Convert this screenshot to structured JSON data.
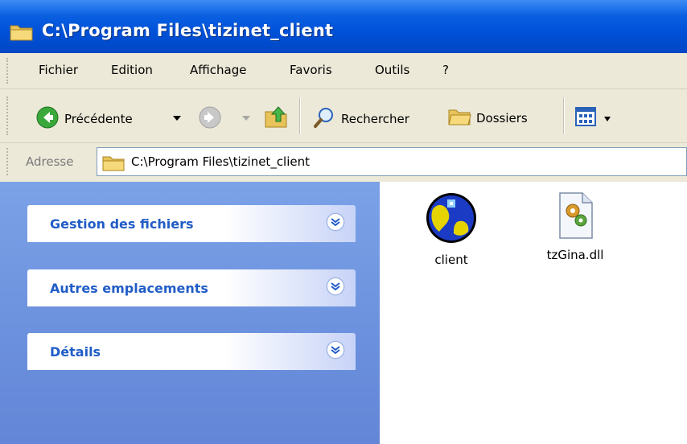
{
  "window": {
    "title": "C:\\Program Files\\tizinet_client"
  },
  "menu": {
    "items": [
      "Fichier",
      "Edition",
      "Affichage",
      "Favoris",
      "Outils",
      "?"
    ]
  },
  "toolbar": {
    "back_label": "Précédente",
    "search_label": "Rechercher",
    "folders_label": "Dossiers"
  },
  "address": {
    "label": "Adresse",
    "value": "C:\\Program Files\\tizinet_client"
  },
  "tasks": {
    "panels": [
      {
        "title": "Gestion des fichiers",
        "icon": "chevron-down-icon"
      },
      {
        "title": "Autres emplacements",
        "icon": "chevron-down-icon"
      },
      {
        "title": "Détails",
        "icon": "chevron-down-icon"
      }
    ]
  },
  "files": [
    {
      "name": "client",
      "icon": "globe-app-icon"
    },
    {
      "name": "tzGina.dll",
      "icon": "dll-file-icon"
    }
  ],
  "colors": {
    "titlebar": "#0a5fe0",
    "taskpane": "#6b90dd",
    "panel_title": "#215dc6"
  }
}
